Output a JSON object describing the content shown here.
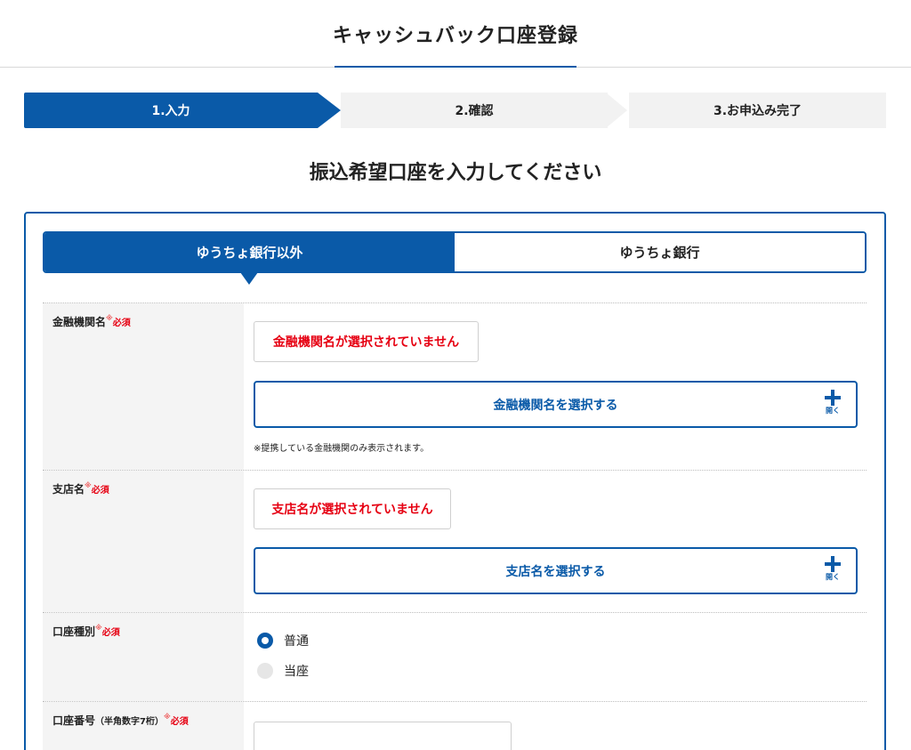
{
  "header": {
    "title": "キャッシュバック口座登録"
  },
  "steps": [
    {
      "label": "1.入力",
      "active": true
    },
    {
      "label": "2.確認",
      "active": false
    },
    {
      "label": "3.お申込み完了",
      "active": false
    }
  ],
  "section_title": "振込希望口座を入力してください",
  "tabs": [
    {
      "label": "ゆうちょ銀行以外",
      "active": true
    },
    {
      "label": "ゆうちょ銀行",
      "active": false
    }
  ],
  "form": {
    "required_mark": "※",
    "required_text": "必須",
    "bank": {
      "label": "金融機関名",
      "status": "金融機関名が選択されていません",
      "button": "金融機関名を選択する",
      "open_label": "開く",
      "note": "※提携している金融機関のみ表示されます。"
    },
    "branch": {
      "label": "支店名",
      "status": "支店名が選択されていません",
      "button": "支店名を選択する",
      "open_label": "開く"
    },
    "account_type": {
      "label": "口座種別",
      "options": [
        {
          "label": "普通",
          "checked": true
        },
        {
          "label": "当座",
          "checked": false
        }
      ]
    },
    "account_number": {
      "label": "口座番号",
      "sub_label": "（半角数字7桁）",
      "value": ""
    }
  },
  "colors": {
    "primary": "#0a5aa8",
    "error": "#e60012",
    "step_inactive": "#f2f2f2",
    "label_bg": "#f4f4f4"
  }
}
